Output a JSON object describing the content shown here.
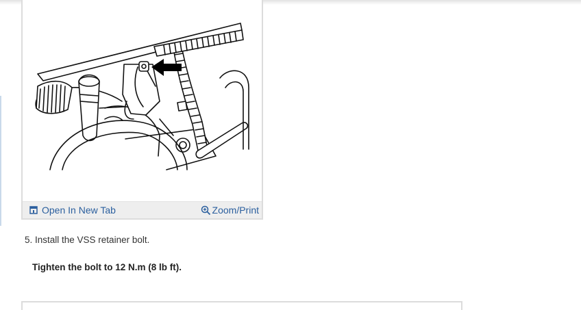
{
  "figure": {
    "open_new_tab_label": "Open In New Tab",
    "zoom_print_label": "Zoom/Print"
  },
  "procedure": {
    "step_text": "5. Install the VSS retainer bolt.",
    "spec_text": "Tighten the bolt to 12 N.m (8 lb ft)."
  }
}
